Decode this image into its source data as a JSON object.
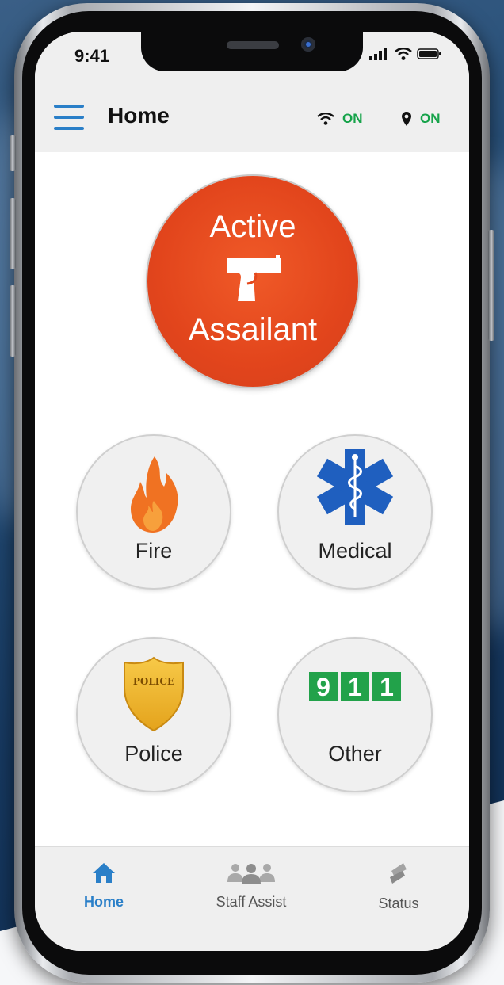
{
  "status_bar": {
    "time": "9:41"
  },
  "header": {
    "title": "Home",
    "wifi_status": "ON",
    "location_status": "ON"
  },
  "emergency_buttons": {
    "active_assailant": {
      "line1": "Active",
      "line2": "Assailant",
      "icon": "pistol-icon",
      "color": "#e4481c"
    },
    "fire": {
      "label": "Fire",
      "icon": "flame-icon"
    },
    "medical": {
      "label": "Medical",
      "icon": "star-of-life-icon"
    },
    "police": {
      "label": "Police",
      "icon": "police-badge-icon",
      "badge_text": "POLICE"
    },
    "other": {
      "label": "Other",
      "icon": "911-icon",
      "digits": [
        "9",
        "1",
        "1"
      ]
    }
  },
  "tab_bar": {
    "tabs": [
      {
        "label": "Home",
        "icon": "home-icon",
        "active": true
      },
      {
        "label": "Staff Assist",
        "icon": "staff-group-icon",
        "active": false
      },
      {
        "label": "Status",
        "icon": "status-icon",
        "active": false
      }
    ]
  },
  "colors": {
    "accent": "#2a7fc8",
    "on_status": "#16a34a",
    "alert": "#e4481c",
    "green_911": "#22a24a",
    "medical_blue": "#1f5fbf"
  }
}
